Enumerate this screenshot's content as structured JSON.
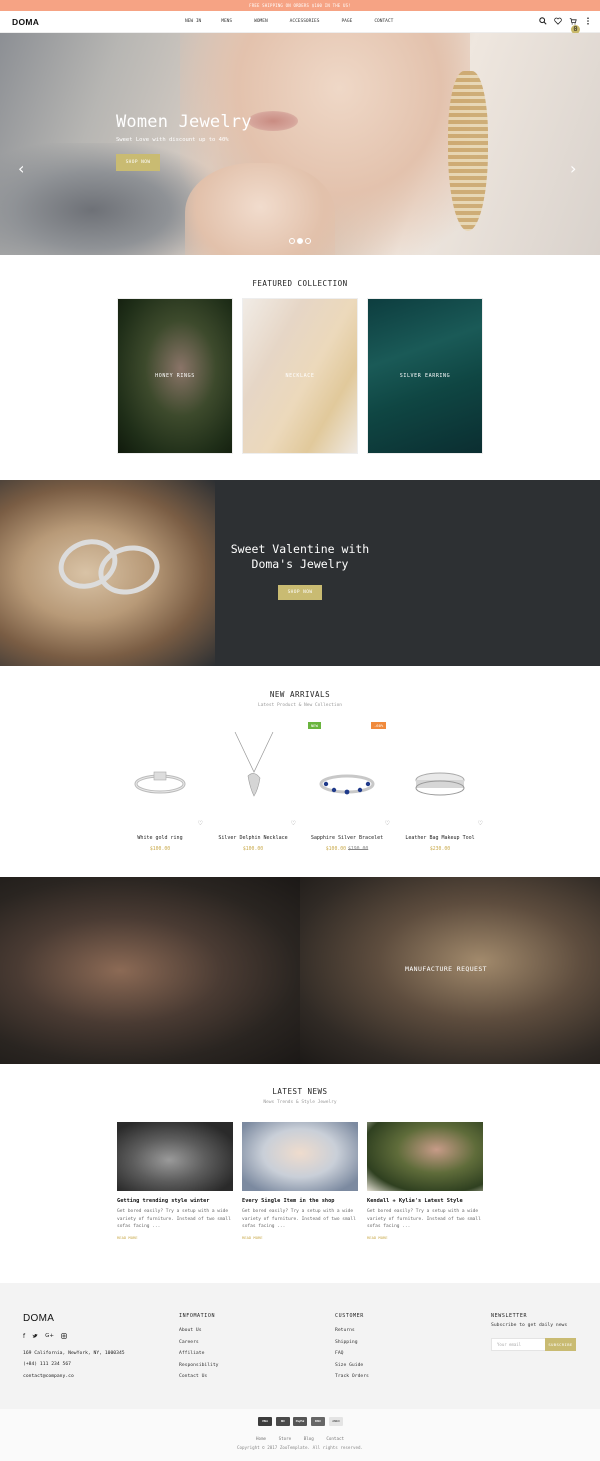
{
  "topbar": {
    "text": "FREE SHIPPING ON ORDERS $100 IN THE US!"
  },
  "nav": {
    "logo": "DOMA",
    "menu": [
      "NEW IN",
      "MENS",
      "WOMEN",
      "ACCESSORIES",
      "PAGE",
      "CONTACT"
    ],
    "cart_count": "0"
  },
  "hero": {
    "title": "Women Jewelry",
    "subtitle": "Sweet Love with discount up to 40%",
    "button": "SHOP NOW",
    "prev": "‹",
    "next": "›"
  },
  "featured": {
    "title": "FEATURED COLLECTION",
    "cards": [
      "HONEY RINGS",
      "NECKLACE",
      "SILVER EARRING"
    ]
  },
  "valentine": {
    "line1": "Sweet Valentine with",
    "line2": "Doma's Jewelry",
    "button": "SHOP NOW"
  },
  "arrivals": {
    "title": "NEW ARRIVALS",
    "subtitle": "Latest Product & New Collection",
    "products": [
      {
        "name": "White gold ring",
        "price": "$100.00",
        "old_price": "",
        "tag": ""
      },
      {
        "name": "Silver Delphin Necklace",
        "price": "$100.00",
        "old_price": "",
        "tag": ""
      },
      {
        "name": "Sapphire Silver Bracelet",
        "price": "$100.00",
        "old_price": "$190.00",
        "tag": "NEW"
      },
      {
        "name": "Leather Bag Makeup Tool",
        "price": "$230.00",
        "old_price": "",
        "tag": "-60%"
      }
    ]
  },
  "manufacture": {
    "label": "MANUFACTURE REQUEST"
  },
  "news": {
    "title": "LATEST NEWS",
    "subtitle": "News Trends & Style Jewelry",
    "posts": [
      {
        "title": "Getting trending style winter",
        "excerpt": "Get bored easily? Try a setup with a wide variety of furniture. Instead of two small sofas facing ...",
        "more": "READ MORE"
      },
      {
        "title": "Every Single Item in the shop",
        "excerpt": "Get bored easily? Try a setup with a wide variety of furniture. Instead of two small sofas facing ...",
        "more": "READ MORE"
      },
      {
        "title": "Kendall + Kylie's Latest Style",
        "excerpt": "Get bored easily? Try a setup with a wide variety of furniture. Instead of two small sofas facing ...",
        "more": "READ MORE"
      }
    ]
  },
  "footer": {
    "logo": "DOMA",
    "address": "169 California, NewYork, NY, 1000345",
    "phone": "(+84) 111 234 567",
    "email": "contact@company.co",
    "information": {
      "title": "INFOMATION",
      "links": [
        "About Us",
        "Careers",
        "Affiliate",
        "Responsibility",
        "Contact Us"
      ]
    },
    "customer": {
      "title": "CUSTOMER",
      "links": [
        "Returns",
        "Shipping",
        "FAQ",
        "Size Guide",
        "Track Orders"
      ]
    },
    "newsletter": {
      "title": "NEWSLETTER",
      "text": "Subscribe to get daily news",
      "placeholder": "Your email",
      "button": "SUBSCRIBE"
    },
    "payments": [
      "VISA",
      "MC",
      "PayPal",
      "DISC",
      "AMEX"
    ],
    "bottom_links": [
      "Home",
      "Store",
      "Blog",
      "Contact"
    ],
    "copyright": "Copyright © 2017  ZooTemplate. All rights reserved."
  },
  "colors": {
    "accent": "#c9bb72",
    "topbar": "#f6a384",
    "tag_new": "#6ab43e",
    "tag_sale": "#f08a3c"
  }
}
